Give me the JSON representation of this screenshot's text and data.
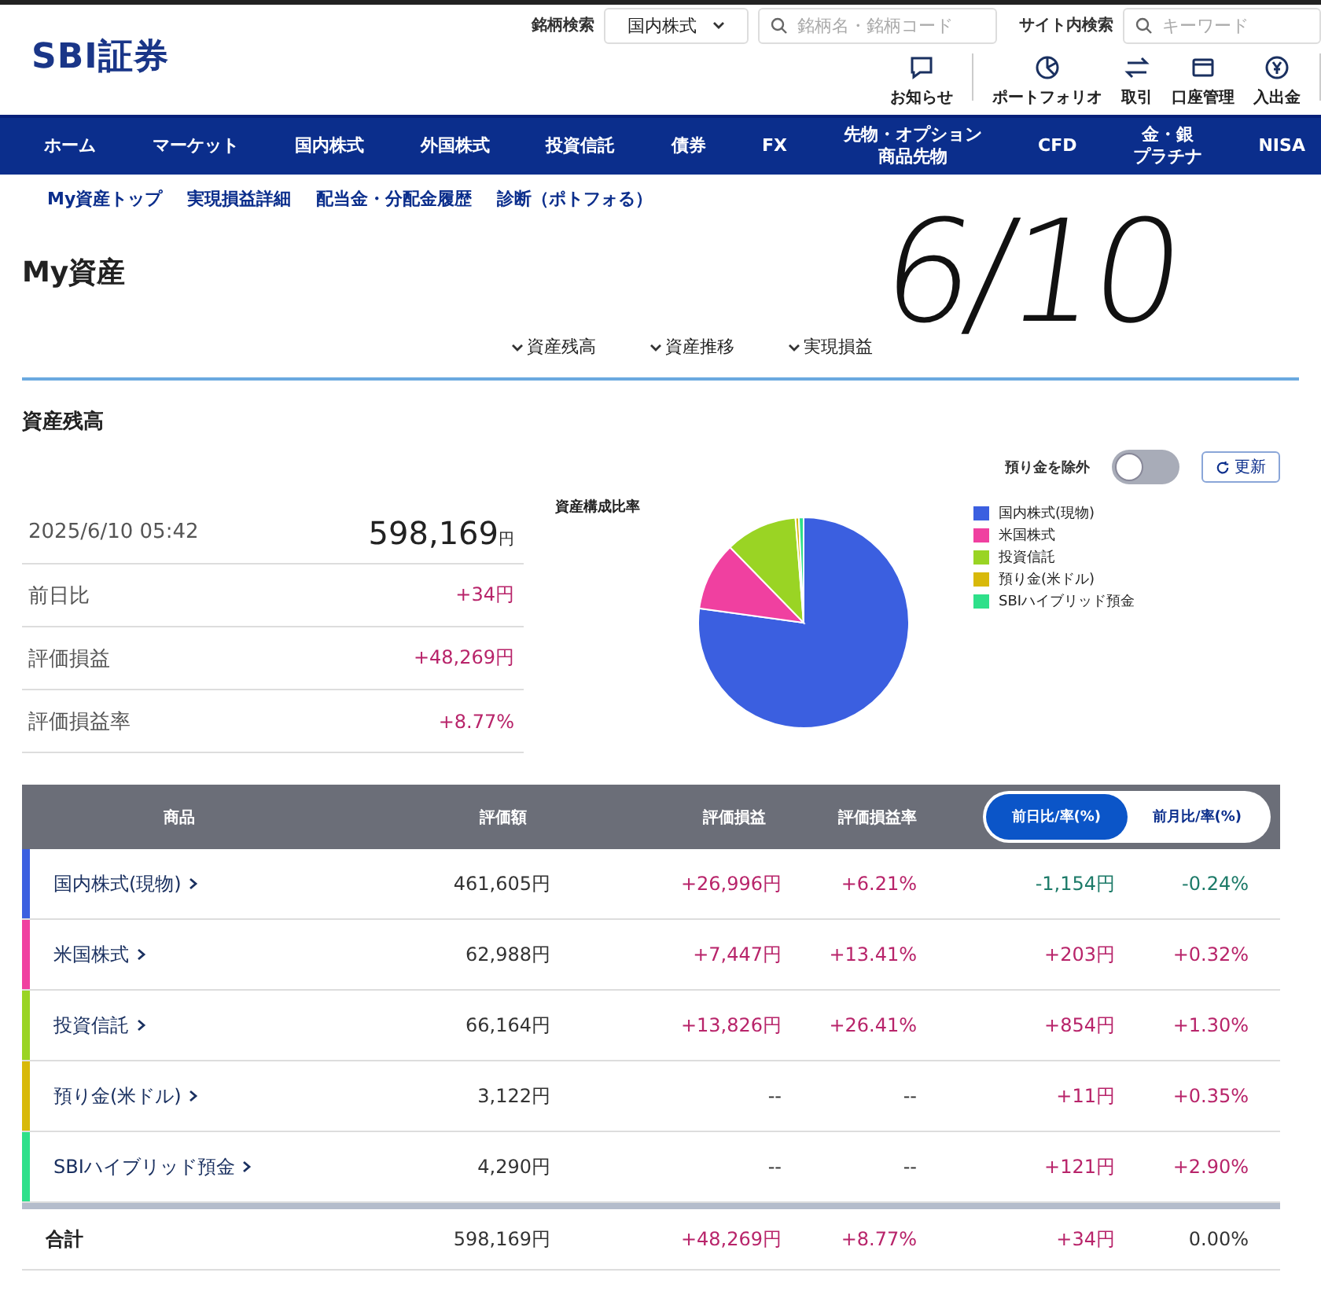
{
  "header": {
    "logo": "SBI証券",
    "stock_search": {
      "label": "銘柄検索",
      "market": "国内株式",
      "placeholder": "銘柄名・銘柄コード"
    },
    "site_search": {
      "label": "サイト内検索",
      "placeholder": "キーワード"
    },
    "shortcuts": [
      {
        "kind": "message",
        "label": "お知らせ"
      },
      {
        "kind": "pie",
        "label": "ポートフォリオ"
      },
      {
        "kind": "swap",
        "label": "取引"
      },
      {
        "kind": "card",
        "label": "口座管理"
      },
      {
        "kind": "yen",
        "label": "入出金"
      }
    ]
  },
  "main_nav": [
    {
      "label": "ホーム"
    },
    {
      "label": "マーケット"
    },
    {
      "label": "国内株式"
    },
    {
      "label": "外国株式"
    },
    {
      "label": "投資信託"
    },
    {
      "label": "債券"
    },
    {
      "label": "FX"
    },
    {
      "lines": [
        "先物・オプション",
        "商品先物"
      ]
    },
    {
      "label": "CFD"
    },
    {
      "lines": [
        "金・銀",
        "プラチナ"
      ]
    },
    {
      "label": "NISA"
    }
  ],
  "sub_nav": [
    "My資産トップ",
    "実現損益詳細",
    "配当金・分配金履歴",
    "診断（ポトフォる）"
  ],
  "page_title": "My資産",
  "handwritten_note": "6/10",
  "anchor_links": [
    "資産残高",
    "資産推移",
    "実現損益"
  ],
  "section_title": "資産残高",
  "exclude_deposit": {
    "label": "預り金を除外",
    "on": false
  },
  "refresh_button": "更新",
  "summary": {
    "datetime": "2025/6/10 05:42",
    "total": "598,169",
    "total_unit": "円",
    "rows": [
      {
        "label": "前日比",
        "value": "+34円"
      },
      {
        "label": "評価損益",
        "value": "+48,269円"
      },
      {
        "label": "評価損益率",
        "value": "+8.77%"
      }
    ]
  },
  "chart": {
    "title": "資産構成比率",
    "legend": [
      {
        "label": "国内株式(現物)",
        "color": "#3b5fe0"
      },
      {
        "label": "米国株式",
        "color": "#f040a0"
      },
      {
        "label": "投資信託",
        "color": "#9ad424"
      },
      {
        "label": "預り金(米ドル)",
        "color": "#d8b90a"
      },
      {
        "label": "SBIハイブリッド預金",
        "color": "#2ee08a"
      }
    ]
  },
  "table": {
    "columns": [
      "商品",
      "評価額",
      "評価損益",
      "評価損益率"
    ],
    "toggle": [
      {
        "label": "前日比/率(%)",
        "selected": true
      },
      {
        "label": "前月比/率(%)",
        "selected": false
      }
    ],
    "rows": [
      {
        "color": "#3b5fe0",
        "cells": [
          {
            "text": "国内株式(現物)"
          },
          {
            "text": "461,605円"
          },
          {
            "text": "+26,996円",
            "color": "#b8246a"
          },
          {
            "text": "+6.21%",
            "color": "#b8246a"
          },
          {
            "text": "-1,154円",
            "color": "#1c7a68"
          },
          {
            "text": "-0.24%",
            "color": "#1c7a68"
          }
        ]
      },
      {
        "color": "#f040a0",
        "cells": [
          {
            "text": "米国株式"
          },
          {
            "text": "62,988円"
          },
          {
            "text": "+7,447円",
            "color": "#b8246a"
          },
          {
            "text": "+13.41%",
            "color": "#b8246a"
          },
          {
            "text": "+203円",
            "color": "#b8246a"
          },
          {
            "text": "+0.32%",
            "color": "#b8246a"
          }
        ]
      },
      {
        "color": "#9ad424",
        "cells": [
          {
            "text": "投資信託"
          },
          {
            "text": "66,164円"
          },
          {
            "text": "+13,826円",
            "color": "#b8246a"
          },
          {
            "text": "+26.41%",
            "color": "#b8246a"
          },
          {
            "text": "+854円",
            "color": "#b8246a"
          },
          {
            "text": "+1.30%",
            "color": "#b8246a"
          }
        ]
      },
      {
        "color": "#d8b90a",
        "cells": [
          {
            "text": "預り金(米ドル)"
          },
          {
            "text": "3,122円"
          },
          {
            "text": "--"
          },
          {
            "text": "--"
          },
          {
            "text": "+11円",
            "color": "#b8246a"
          },
          {
            "text": "+0.35%",
            "color": "#b8246a"
          }
        ]
      },
      {
        "color": "#2ee08a",
        "cells": [
          {
            "text": "SBIハイブリッド預金"
          },
          {
            "text": "4,290円"
          },
          {
            "text": "--"
          },
          {
            "text": "--"
          },
          {
            "text": "+121円",
            "color": "#b8246a"
          },
          {
            "text": "+2.90%",
            "color": "#b8246a"
          }
        ]
      }
    ],
    "total": {
      "cells": [
        {
          "text": "合計"
        },
        {
          "text": "598,169円"
        },
        {
          "text": "+48,269円",
          "color": "#b8246a"
        },
        {
          "text": "+8.77%",
          "color": "#b8246a"
        },
        {
          "text": "+34円",
          "color": "#b8246a"
        },
        {
          "text": "0.00%"
        }
      ]
    }
  }
}
